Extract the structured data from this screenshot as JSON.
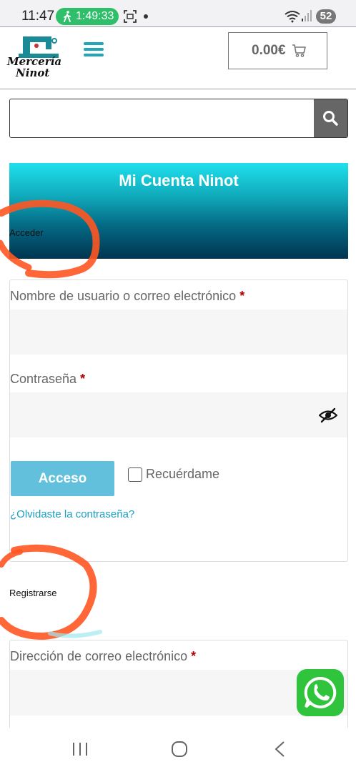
{
  "status_bar": {
    "time": "11:47",
    "activity_timer": "1:49:33",
    "battery": "52"
  },
  "header": {
    "logo_line1": "Mercería",
    "logo_line2": "Ninot",
    "cart_total": "0.00€"
  },
  "search": {
    "value": ""
  },
  "banner": {
    "title": "Mi Cuenta Ninot"
  },
  "login": {
    "section_label": "Acceder",
    "username_label": "Nombre de usuario o correo electrónico",
    "password_label": "Contraseña",
    "required_mark": "*",
    "submit_label": "Acceso",
    "remember_label": "Recuérdame",
    "forgot_link": "¿Olvidaste la contraseña?"
  },
  "register": {
    "section_label": "Registrarse",
    "email_label": "Dirección de correo electrónico",
    "required_mark": "*"
  },
  "colors": {
    "accent": "#1fa7b7",
    "button": "#62c0dc",
    "link": "#1a9dc0",
    "required": "#b30000",
    "annotation": "#ff5722",
    "whatsapp": "#2fc43c"
  },
  "icons": [
    "walk-icon",
    "screen-record-icon",
    "wifi-icon",
    "signal-icon",
    "cart-icon",
    "search-icon",
    "eye-off-icon",
    "whatsapp-icon",
    "recent-apps-icon",
    "home-icon",
    "back-icon"
  ]
}
